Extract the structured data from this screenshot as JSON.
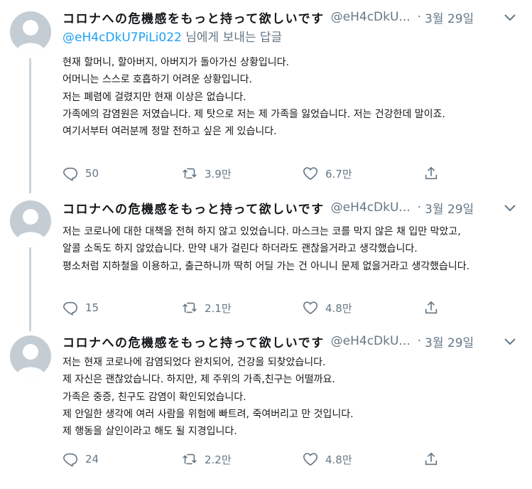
{
  "tweets": [
    {
      "name": "コロナへの危機感をもっと持って欲しいです",
      "handle": "@eH4cDkU...",
      "date": "3월 29일",
      "reply_handle": "@eH4cDkU7PiLi022",
      "reply_suffix": " 님에게 보내는 답글",
      "lines": [
        "현재 할머니, 할아버지, 아버지가 돌아가신 상황입니다.",
        "어머니는 스스로 호흡하기 어려운 상황입니다.",
        "저는 폐렴에 걸렸지만 현재 이상은 없습니다.",
        "가족에의 감염원은 저였습니다. 제 탓으로 저는 제 가족을 잃었습니다. 저는 건강한데 말이죠.",
        "여기서부터 여러분께 정말 전하고 싶은 게 있습니다."
      ],
      "replies": "50",
      "retweets": "3.9만",
      "likes": "6.7만"
    },
    {
      "name": "コロナへの危機感をもっと持って欲しいです",
      "handle": "@eH4cDkU...",
      "date": "3월 29일",
      "lines": [
        "저는 코로나에 대한 대책을 전혀 하지 않고 있었습니다. 마스크는 코를 막지 않은 채 입만 막았고,",
        "알콜 소독도 하지 않았습니다. 만약 내가 걸린다 하더라도 괜찮을거라고 생각했습니다.",
        "평소처럼 지하철을 이용하고, 출근하니까 딱히 어딜 가는 건 아니니 문제 없을거라고 생각했습니다."
      ],
      "replies": "15",
      "retweets": "2.1만",
      "likes": "4.8만"
    },
    {
      "name": "コロナへの危機感をもっと持って欲しいです",
      "handle": "@eH4cDkU...",
      "date": "3월 29일",
      "lines": [
        "저는 현재 코로나에 감염되었다 완치되어, 건강을 되찾았습니다.",
        "제 자신은 괜찮았습니다. 하지만, 제 주위의 가족,친구는 어떨까요.",
        "가족은 중증, 친구도 감염이 확인되었습니다.",
        "제 안일한 생각에 여러 사람을 위험에 빠트려, 죽여버리고 만 것입니다.",
        "제 행동을 살인이라고 해도 될 지경입니다."
      ],
      "replies": "24",
      "retweets": "2.2만",
      "likes": "4.8만"
    }
  ],
  "icons": {
    "reply": "reply-icon",
    "retweet": "retweet-icon",
    "like": "heart-icon",
    "share": "share-icon",
    "caret": "chevron-down-icon"
  },
  "colors": {
    "link": "#1da1f2",
    "secondary": "#657786",
    "thread_line": "#cbd3da",
    "avatar_bg": "#c4ccd4"
  }
}
